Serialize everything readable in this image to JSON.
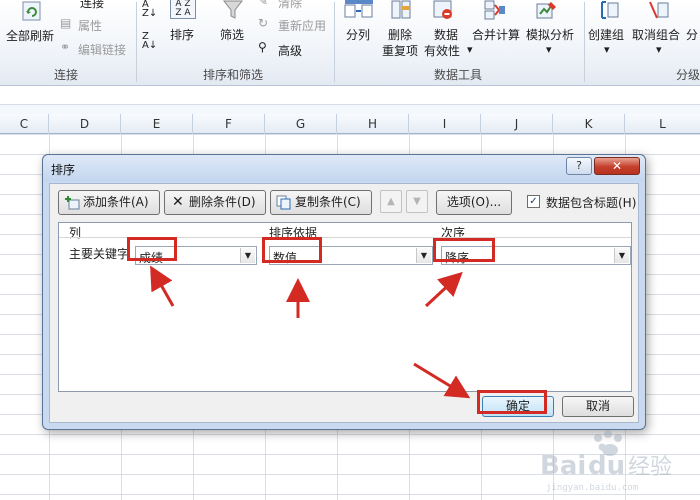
{
  "ribbon": {
    "refresh_all": "全部刷新",
    "connections_top": "连接",
    "properties": "属性",
    "edit_links": "编辑链接",
    "group_connections": "连接",
    "sort": "排序",
    "filter": "筛选",
    "clear": "清除",
    "reapply": "重新应用",
    "advanced": "高级",
    "group_sort_filter": "排序和筛选",
    "text_to_columns": "分列",
    "remove_dup_1": "删除",
    "remove_dup_2": "重复项",
    "validation_1": "数据",
    "validation_2": "有效性",
    "consolidate": "合并计算",
    "what_if": "模拟分析",
    "group_data_tools": "数据工具",
    "group": "创建组",
    "ungroup": "取消组合",
    "subtotal": "分",
    "group_outline": "分级"
  },
  "sheet": {
    "columns": [
      "C",
      "D",
      "E",
      "F",
      "G",
      "H",
      "I",
      "J",
      "K",
      "L"
    ]
  },
  "dialog": {
    "title": "排序",
    "help": "?",
    "close": "✕",
    "add_level": "添加条件(A)",
    "delete_level": "删除条件(D)",
    "copy_level": "复制条件(C)",
    "move_up": "▲",
    "move_down": "▼",
    "options": "选项(O)...",
    "has_headers_checked": "✓",
    "has_headers": "数据包含标题(H)",
    "col_header": "列",
    "sort_on_header": "排序依据",
    "order_header": "次序",
    "row_label": "主要关键字",
    "column_value": "成绩",
    "sort_on_value": "数值",
    "order_value": "降序",
    "ok": "确定",
    "cancel": "取消"
  },
  "colors": {
    "annotation_red": "#d42a24",
    "dialog_frame": "#c9daf0"
  }
}
